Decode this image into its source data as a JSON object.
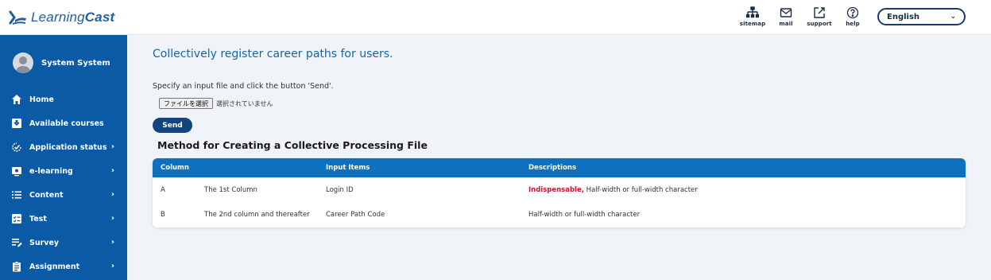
{
  "header": {
    "logo_text_regular": "Learning",
    "logo_text_bold": "Cast",
    "tools": [
      {
        "icon": "sitemap-icon",
        "label": "sitemap"
      },
      {
        "icon": "mail-icon",
        "label": "mail"
      },
      {
        "icon": "support-icon",
        "label": "support"
      },
      {
        "icon": "help-icon",
        "label": "help"
      }
    ],
    "language": "English"
  },
  "sidebar": {
    "user_name": "System System",
    "items": [
      {
        "label": "Home",
        "icon": "home-icon",
        "has_arrow": false
      },
      {
        "label": "Available courses",
        "icon": "courses-icon",
        "has_arrow": false
      },
      {
        "label": "Application status",
        "icon": "status-icon",
        "has_arrow": true
      },
      {
        "label": "e-learning",
        "icon": "elearning-icon",
        "has_arrow": true
      },
      {
        "label": "Content",
        "icon": "list-icon",
        "has_arrow": true
      },
      {
        "label": "Test",
        "icon": "test-icon",
        "has_arrow": true
      },
      {
        "label": "Survey",
        "icon": "survey-icon",
        "has_arrow": true
      },
      {
        "label": "Assignment",
        "icon": "assignment-icon",
        "has_arrow": true
      }
    ]
  },
  "main": {
    "title": "Collectively register career paths for users.",
    "instruction": "Specify an input file and click the button 'Send'.",
    "file_button": "ファイルを選択",
    "file_status": "選択されていません",
    "send_label": "Send",
    "section_title": "Method for Creating a Collective Processing File",
    "table": {
      "headers": [
        "Column",
        "Input Items",
        "Descriptions"
      ],
      "rows": [
        {
          "col": "A",
          "col_desc": "The 1st Column",
          "input": "Login ID",
          "required": "Indispensable,",
          "description": " Half-width or full-width character"
        },
        {
          "col": "B",
          "col_desc": "The 2nd column and thereafter",
          "input": "Career Path Code",
          "required": "",
          "description": "Half-width or full-width character"
        }
      ]
    }
  },
  "colors": {
    "sidebar": "#0b5aa6",
    "table_header": "#0e71c0",
    "send_button": "#12447e",
    "required_text": "#d0142c",
    "title": "#1565a8"
  }
}
